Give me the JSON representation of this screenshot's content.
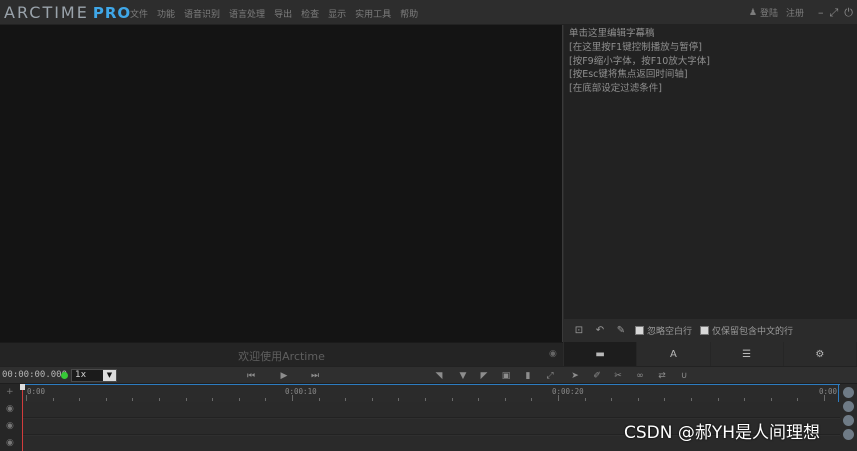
{
  "app": {
    "logo_main": "ARCTIME",
    "logo_pro": "PRO"
  },
  "menu": [
    "文件",
    "功能",
    "语音识别",
    "语言处理",
    "导出",
    "检查",
    "显示",
    "实用工具",
    "帮助"
  ],
  "window_links": {
    "login": "登陆",
    "register": "注册"
  },
  "editor": {
    "lines": [
      "单击这里编辑字幕稿",
      "[在这里按F1键控制播放与暂停]",
      "[按F9缩小字体，按F10放大字体]",
      "[按Esc键将焦点返回时间轴]",
      "[在底部设定过滤条件]"
    ],
    "option_ignore_empty": "忽略空白行",
    "option_chinese_only": "仅保留包含中文的行"
  },
  "video": {
    "welcome": "欢迎使用Arctime"
  },
  "toolbar": {
    "timecode": "00:00:00.000",
    "speed": "1x"
  },
  "timeline": {
    "ruler_labels": [
      "0:00",
      "0:00:10",
      "0:00:20",
      "0:00"
    ]
  },
  "tabs": [
    {
      "icon": "speech-bubble-icon",
      "glyph": "💬"
    },
    {
      "icon": "font-icon",
      "glyph": "A"
    },
    {
      "icon": "list-icon",
      "glyph": "☰"
    },
    {
      "icon": "gear-icon",
      "glyph": "⚙"
    }
  ],
  "watermark": "CSDN @郝YH是人间理想",
  "colors": {
    "accent": "#3fa7e8",
    "playhead": "#d23c3c",
    "status_dot": "#37c837"
  }
}
